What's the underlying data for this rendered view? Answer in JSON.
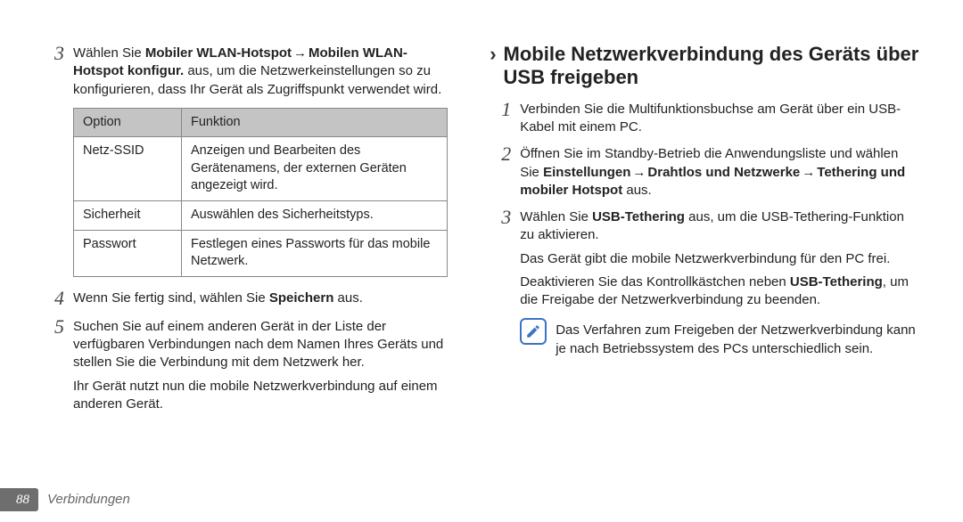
{
  "left": {
    "steps": {
      "3": {
        "pre": "Wählen Sie ",
        "bold1": "Mobiler WLAN-Hotspot",
        "arrow": " → ",
        "bold2": "Mobilen WLAN-Hotspot konfigur.",
        "post": " aus, um die Netzwerkeinstellungen so zu konfigurieren, dass Ihr Gerät als Zugriffspunkt verwendet wird."
      },
      "4": {
        "pre": "Wenn Sie fertig sind, wählen Sie ",
        "bold": "Speichern",
        "post": " aus."
      },
      "5": {
        "text": "Suchen Sie auf einem anderen Gerät in der Liste der verfügbaren Verbindungen nach dem Namen Ihres Geräts und stellen Sie die Verbindung mit dem Netzwerk her.",
        "cont": "Ihr Gerät nutzt nun die mobile Netzwerkverbindung auf einem anderen Gerät."
      }
    },
    "table": {
      "head": {
        "c1": "Option",
        "c2": "Funktion"
      },
      "rows": [
        {
          "c1": "Netz-SSID",
          "c2": "Anzeigen und Bearbeiten des Gerätenamens, der externen Geräten angezeigt wird."
        },
        {
          "c1": "Sicherheit",
          "c2": "Auswählen des Sicherheitstyps."
        },
        {
          "c1": "Passwort",
          "c2": "Festlegen eines Passworts für das mobile Netzwerk."
        }
      ]
    }
  },
  "right": {
    "heading": "Mobile Netzwerkverbindung des Geräts über USB freigeben",
    "steps": {
      "1": {
        "text": "Verbinden Sie die Multifunktionsbuchse am Gerät über ein USB-Kabel mit einem PC."
      },
      "2": {
        "pre": "Öffnen Sie im Standby-Betrieb die Anwendungsliste und wählen Sie ",
        "bold1": "Einstellungen",
        "arrow1": " → ",
        "bold2": "Drahtlos und Netzwerke",
        "arrow2": " → ",
        "bold3": "Tethering und mobiler Hotspot",
        "post": " aus."
      },
      "3": {
        "pre": "Wählen Sie ",
        "bold": "USB-Tethering",
        "post": " aus, um die USB-Tethering-Funktion zu aktivieren.",
        "cont1": "Das Gerät gibt die mobile Netzwerkverbindung für den PC frei.",
        "cont2a": "Deaktivieren Sie das Kontrollkästchen neben ",
        "cont2b": "USB-Tethering",
        "cont2c": ", um die Freigabe der Netzwerkverbindung zu beenden."
      }
    },
    "note": "Das Verfahren zum Freigeben der Netzwerkverbindung kann je nach Betriebssystem des PCs unterschiedlich sein."
  },
  "footer": {
    "page": "88",
    "section": "Verbindungen"
  }
}
